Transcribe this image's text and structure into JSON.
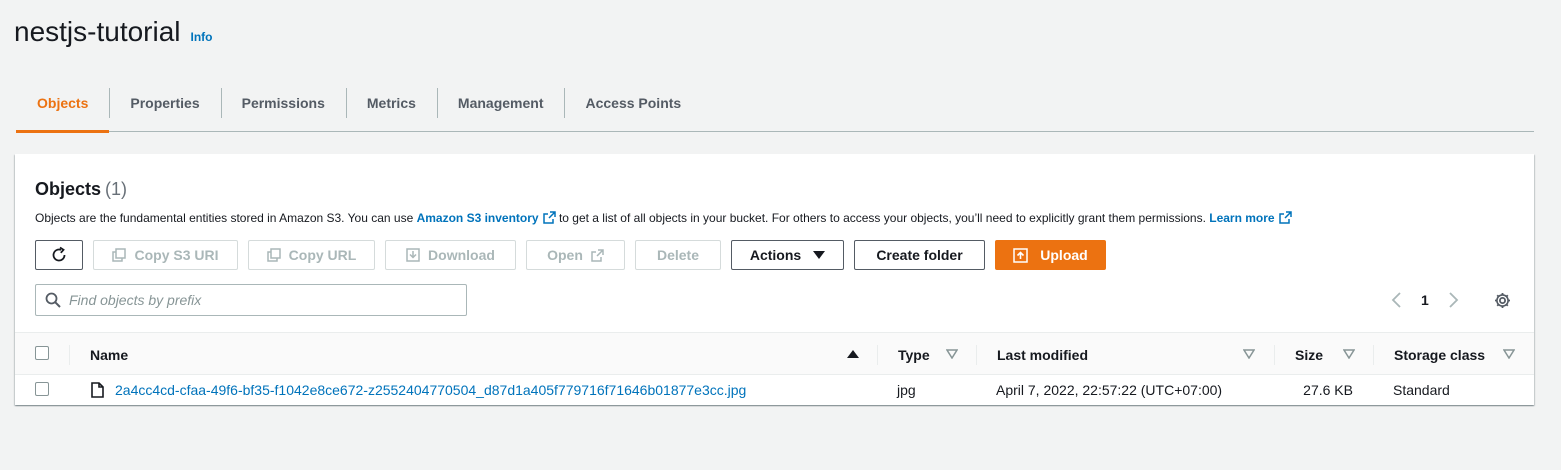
{
  "header": {
    "title": "nestjs-tutorial",
    "info_label": "Info"
  },
  "tabs": [
    {
      "label": "Objects",
      "active": true
    },
    {
      "label": "Properties"
    },
    {
      "label": "Permissions"
    },
    {
      "label": "Metrics"
    },
    {
      "label": "Management"
    },
    {
      "label": "Access Points"
    }
  ],
  "objects_panel": {
    "title": "Objects",
    "count": "(1)",
    "description": {
      "part1": "Objects are the fundamental entities stored in Amazon S3. You can use ",
      "link1": "Amazon S3 inventory",
      "part2": " to get a list of all objects in your bucket. For others to access your objects, you’ll need to explicitly grant them permissions. ",
      "link2": "Learn more"
    },
    "toolbar": {
      "copy_s3_uri": "Copy S3 URI",
      "copy_url": "Copy URL",
      "download": "Download",
      "open": "Open",
      "delete": "Delete",
      "actions": "Actions",
      "create_folder": "Create folder",
      "upload": "Upload"
    },
    "search": {
      "placeholder": "Find objects by prefix",
      "value": ""
    },
    "pagination": {
      "current_page": "1"
    },
    "columns": {
      "name": "Name",
      "type": "Type",
      "last_modified": "Last modified",
      "size": "Size",
      "storage_class": "Storage class"
    },
    "rows": [
      {
        "name": "2a4cc4cd-cfaa-49f6-bf35-f1042e8ce672-z2552404770504_d87d1a405f779716f71646b01877e3cc.jpg",
        "type": "jpg",
        "last_modified": "April 7, 2022, 22:57:22 (UTC+07:00)",
        "size": "27.6 KB",
        "storage_class": "Standard"
      }
    ]
  },
  "colors": {
    "accent": "#ec7211",
    "link": "#0073bb",
    "text": "#16191f",
    "background": "#f2f3f3"
  },
  "icons": [
    "refresh-icon",
    "copy-icon",
    "download-icon",
    "external-link-icon",
    "caret-down-icon",
    "upload-icon",
    "search-icon",
    "chevron-left-icon",
    "chevron-right-icon",
    "gear-icon",
    "sort-ascending-icon",
    "sort-icon",
    "file-icon"
  ]
}
